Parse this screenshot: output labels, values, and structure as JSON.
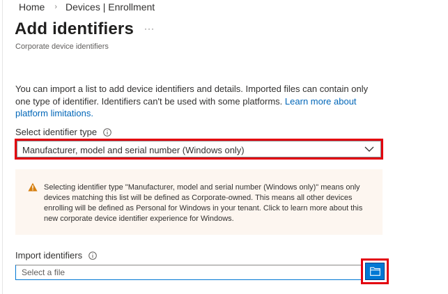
{
  "breadcrumb": {
    "items": [
      "Home",
      "Devices | Enrollment"
    ],
    "separator": "›"
  },
  "header": {
    "title": "Add identifiers",
    "more_label": "···",
    "subtitle": "Corporate device identifiers"
  },
  "description": {
    "text": "You can import a list to add device identifiers and details. Imported files can contain only one type of identifier. Identifiers can't be used with some platforms.",
    "link_text": "Learn more about platform limitations."
  },
  "identifier_type": {
    "label": "Select identifier type",
    "selected": "Manufacturer, model and serial number (Windows only)"
  },
  "warning": {
    "text": "Selecting identifier type \"Manufacturer, model and serial number (Windows only)\" means only devices matching this list will be defined as Corporate-owned. This means all other devices enrolling will be defined as Personal for Windows in your tenant. Click to learn more about this new corporate device identifier experience for Windows."
  },
  "import": {
    "label": "Import identifiers",
    "placeholder": "Select a file"
  },
  "icons": {
    "info": "info-icon",
    "chevron": "chevron-down-icon",
    "warning": "warning-icon",
    "folder": "folder-icon"
  },
  "colors": {
    "accent": "#0078d4",
    "link": "#0066b8",
    "highlight": "#e3000f",
    "warning_bg": "#fdf6f0",
    "warning_icon": "#d67f0f"
  }
}
